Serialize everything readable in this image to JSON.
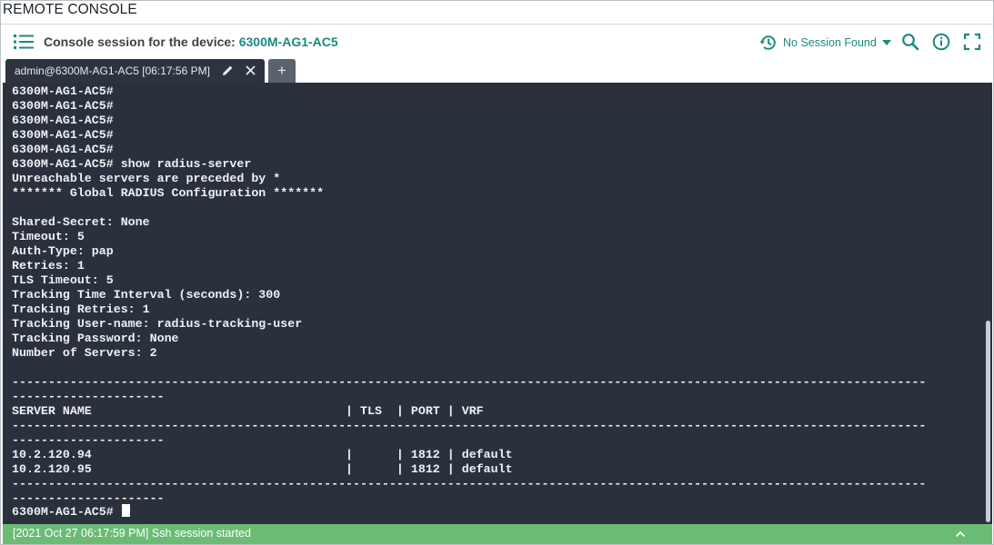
{
  "window": {
    "title": "REMOTE CONSOLE"
  },
  "header": {
    "title_prefix": "Console session for the device: ",
    "device_name": "6300M-AG1-AC5",
    "session_status": "No Session Found",
    "icons": [
      "list-icon",
      "history-icon",
      "caret-down-icon",
      "search-icon",
      "info-icon",
      "expand-icon"
    ],
    "accent_color": "#1b8a7d"
  },
  "tabs": [
    {
      "label": "admin@6300M-AG1-AC5 [06:17:56 PM]",
      "edit_icon": "pencil-icon",
      "close_icon": "close-icon"
    }
  ],
  "add_tab_label": "+",
  "terminal": {
    "background_color": "#2b313c",
    "lines": [
      "6300M-AG1-AC5#",
      "6300M-AG1-AC5#",
      "6300M-AG1-AC5#",
      "6300M-AG1-AC5#",
      "6300M-AG1-AC5#",
      "6300M-AG1-AC5# show radius-server",
      "Unreachable servers are preceded by *",
      "******* Global RADIUS Configuration *******",
      "",
      "Shared-Secret: None",
      "Timeout: 5",
      "Auth-Type: pap",
      "Retries: 1",
      "TLS Timeout: 5",
      "Tracking Time Interval (seconds): 300",
      "Tracking Retries: 1",
      "Tracking User-name: radius-tracking-user",
      "Tracking Password: None",
      "Number of Servers: 2",
      "",
      "------------------------------------------------------------------------------------------------------------------------------",
      "---------------------",
      "SERVER NAME                                   | TLS  | PORT | VRF",
      "------------------------------------------------------------------------------------------------------------------------------",
      "---------------------",
      "10.2.120.94                                   |      | 1812 | default",
      "10.2.120.95                                   |      | 1812 | default",
      "------------------------------------------------------------------------------------------------------------------------------",
      "---------------------"
    ],
    "prompt": "6300M-AG1-AC5# "
  },
  "status": {
    "message": "[2021 Oct 27 06:17:59 PM] Ssh session started",
    "color": "#6cbb75",
    "toggle_icon": "chevron-up-icon"
  }
}
